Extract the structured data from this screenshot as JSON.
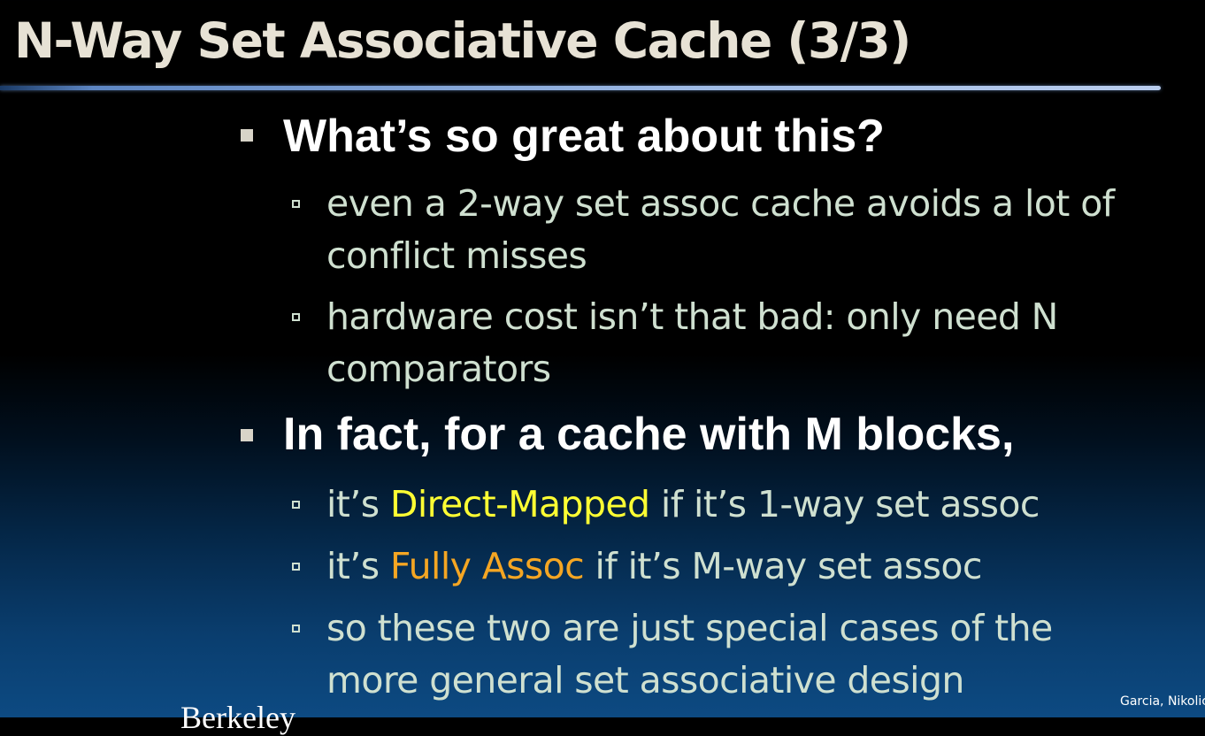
{
  "slide": {
    "title": "N-Way Set Associative Cache (3/3)"
  },
  "bullets": [
    {
      "text": "What’s so great about this?",
      "sub": [
        {
          "lines": [
            "even a 2-way set assoc cache avoids a lot of",
            "conflict misses"
          ]
        },
        {
          "lines": [
            "hardware cost isn’t that bad: only need N",
            "comparators"
          ]
        }
      ]
    },
    {
      "text": "In fact, for a cache with M blocks,",
      "sub": [
        {
          "prefix": "it’s ",
          "highlight": "Direct-Mapped",
          "suffix": " if it’s 1-way set assoc"
        },
        {
          "prefix": "it’s ",
          "highlight": "Fully Assoc",
          "suffix": " if it’s M-way set assoc"
        },
        {
          "lines": [
            "so these two are just special cases of the",
            "more general set associative design"
          ]
        }
      ]
    }
  ],
  "footer": {
    "logo_text": "Berkeley",
    "credit": "Garcia, Nikolić"
  },
  "colors": {
    "title": "#e7e2d5",
    "level1_text": "#ffffff",
    "level2_text": "#cfe0d0",
    "highlight_direct_mapped": "#ffff33",
    "highlight_fully_assoc": "#f5a623",
    "title_rule": "#9fbbe6"
  }
}
